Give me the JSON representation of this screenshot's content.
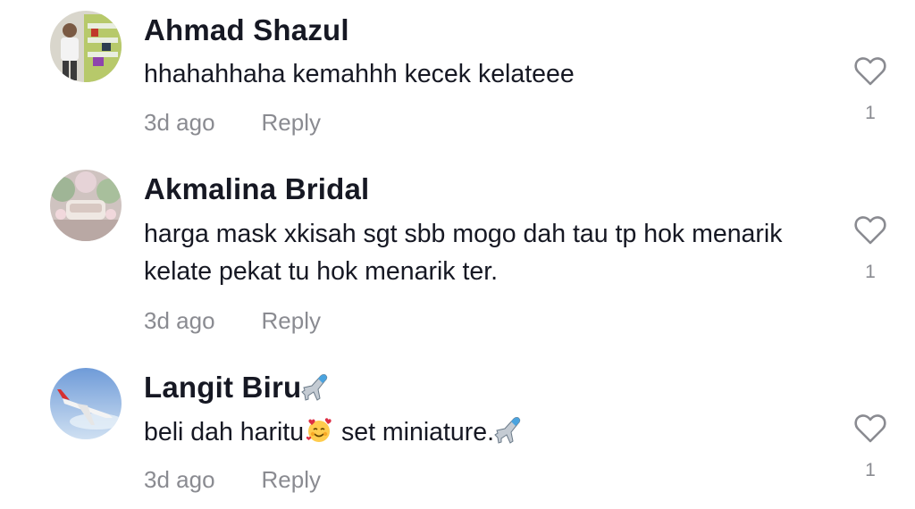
{
  "comments": [
    {
      "avatar": "avatar-person-store",
      "username": "Ahmad Shazul",
      "text": "hhahahhaha kemahhh kecek kelateee",
      "time": "3d ago",
      "reply_label": "Reply",
      "likes": "1"
    },
    {
      "avatar": "avatar-bridal-decor",
      "username": "Akmalina Bridal",
      "text": "harga mask xkisah sgt sbb mogo dah tau tp hok menarik kelate pekat tu hok menarik ter.",
      "time": "3d ago",
      "reply_label": "Reply",
      "likes": "1"
    },
    {
      "avatar": "avatar-airplane-sky",
      "username": "Langit Biru",
      "username_emoji": "airplane-emoji",
      "text_part1": "beli dah haritu",
      "text_emoji1": "smiling-face-with-hearts-emoji",
      "text_part2": " set miniature.",
      "text_emoji2": "airplane-emoji",
      "time": "3d ago",
      "reply_label": "Reply",
      "likes": "1"
    }
  ],
  "colors": {
    "text": "#161823",
    "muted": "#8a8b91",
    "background": "#ffffff"
  },
  "icons": {
    "like": "heart-outline-icon"
  }
}
